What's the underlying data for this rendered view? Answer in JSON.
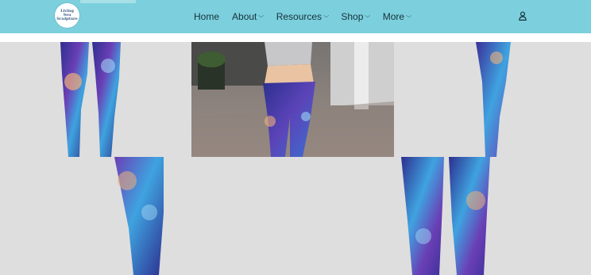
{
  "logo": {
    "line1": "Living",
    "line2": "Sea",
    "line3": "Sculpture"
  },
  "nav": {
    "items": [
      {
        "label": "Home",
        "has_dropdown": false
      },
      {
        "label": "About",
        "has_dropdown": true
      },
      {
        "label": "Resources",
        "has_dropdown": true
      },
      {
        "label": "Shop",
        "has_dropdown": true
      },
      {
        "label": "More",
        "has_dropdown": true
      }
    ],
    "chevron": "⌵"
  },
  "icons": {
    "account": "account-icon",
    "dropdown": "chevron-down-icon"
  },
  "colors": {
    "header": "#7ccfdc",
    "gallery_bg": "#dedede",
    "legging_purple": "#4b3aa8",
    "legging_blue": "#3fa3e0",
    "nav_text": "#14333d"
  }
}
